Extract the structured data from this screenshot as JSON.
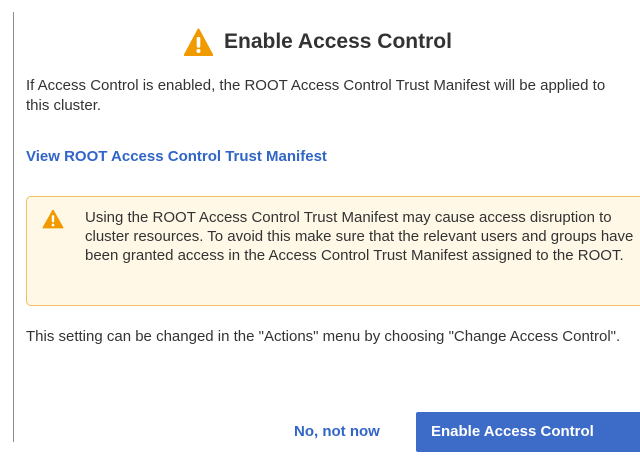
{
  "dialog": {
    "title": "Enable Access Control",
    "title_icon": "warning-icon",
    "intro": "If Access Control is enabled, the ROOT Access Control Trust Manifest will be applied to this cluster.",
    "manifest_link": "View ROOT Access Control Trust Manifest",
    "warning": {
      "icon": "warning-icon",
      "text": "Using the ROOT Access Control Trust Manifest may cause access disruption to cluster resources. To avoid this make sure that the relevant users and groups have been granted access in the Access Control Trust Manifest assigned to the ROOT."
    },
    "footnote": "This setting can be changed in the \"Actions\" menu by choosing \"Change Access Control\".",
    "buttons": {
      "secondary": "No, not now",
      "primary": "Enable Access Control"
    }
  },
  "colors": {
    "accent": "#3d6bc8",
    "link": "#3165c7",
    "warning_icon": "#f09a00",
    "warning_background": "#fff8e7",
    "warning_border": "#f1bf63"
  }
}
